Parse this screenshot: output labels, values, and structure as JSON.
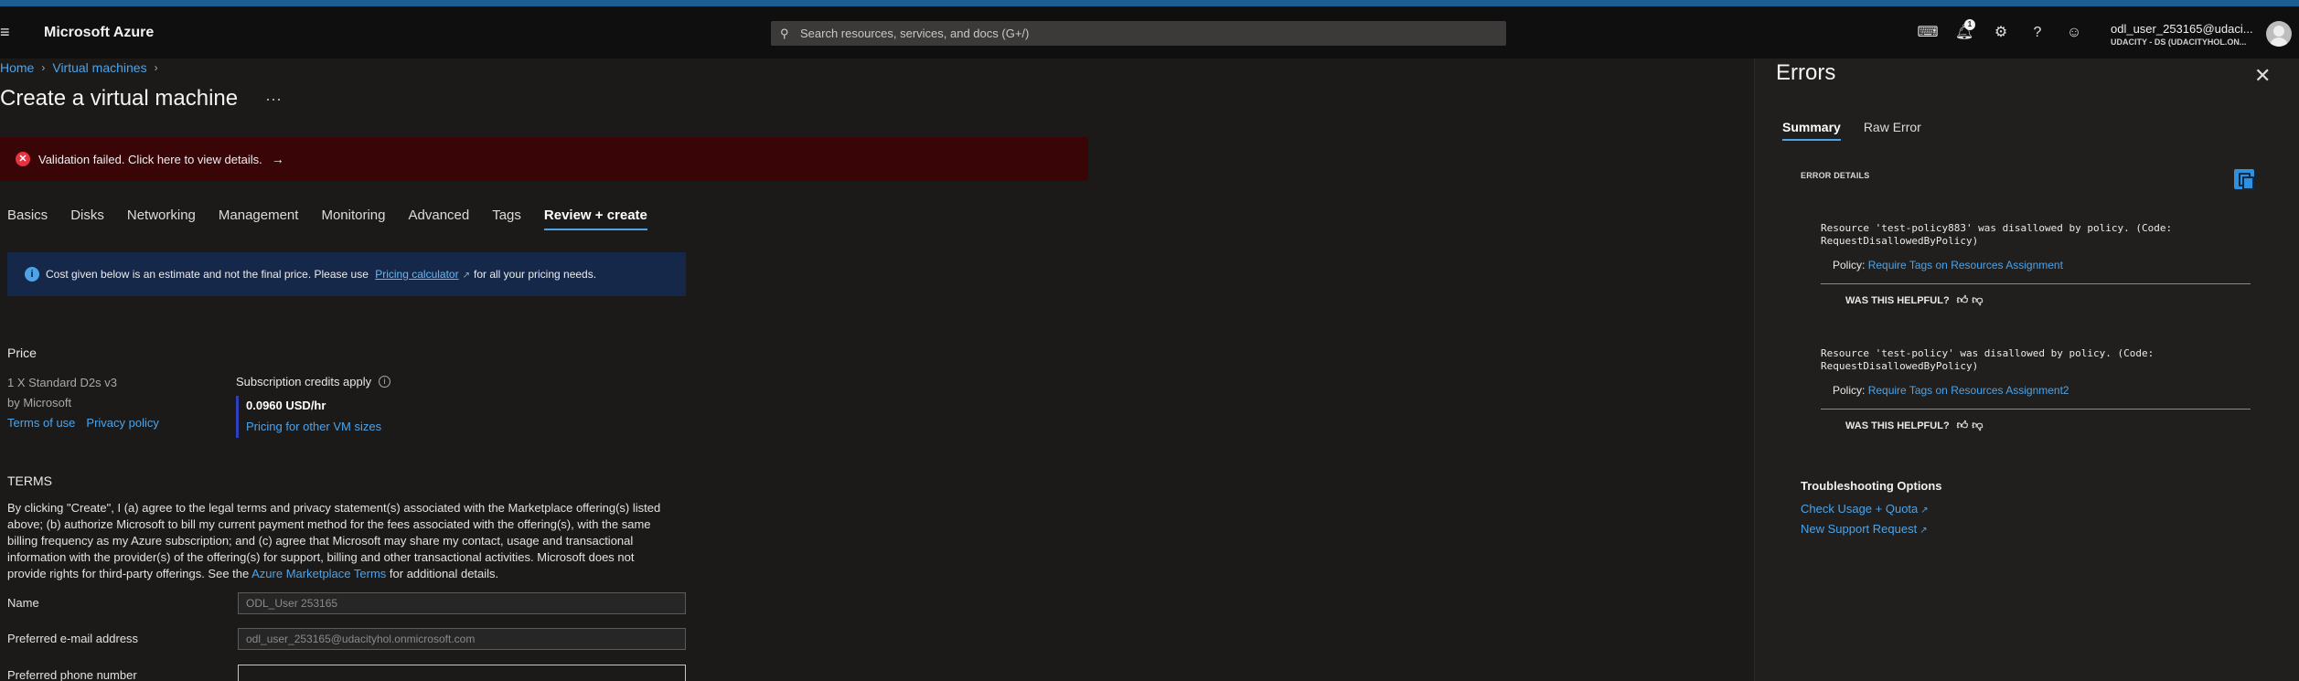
{
  "header": {
    "brand": "Microsoft Azure",
    "search_placeholder": "Search resources, services, and docs (G+/)",
    "notification_count": "1",
    "user_name": "odl_user_253165@udaci...",
    "user_tenant": "UDACITY - DS (UDACITYHOL.ON..."
  },
  "breadcrumb": {
    "home": "Home",
    "virtual_machines": "Virtual machines"
  },
  "page": {
    "title": "Create a virtual machine",
    "more": "···"
  },
  "validation": {
    "text": "Validation failed. Click here to view details.",
    "arrow": "→"
  },
  "tabs": [
    "Basics",
    "Disks",
    "Networking",
    "Management",
    "Monitoring",
    "Advanced",
    "Tags",
    "Review + create"
  ],
  "active_tab": "Review + create",
  "info": {
    "before": "Cost given below is an estimate and not the final price. Please use",
    "link": "Pricing calculator",
    "after": "for all your pricing needs."
  },
  "price": {
    "heading": "Price",
    "vm": "1 X Standard D2s v3",
    "by": "by Microsoft",
    "terms_link": "Terms of use",
    "privacy_link": "Privacy policy",
    "credits": "Subscription credits apply",
    "amount": "0.0960 USD/hr",
    "other_sizes": "Pricing for other VM sizes"
  },
  "terms": {
    "heading": "TERMS",
    "body": "By clicking \"Create\", I (a) agree to the legal terms and privacy statement(s) associated with the Marketplace offering(s) listed above; (b) authorize Microsoft to bill my current payment method for the fees associated with the offering(s), with the same billing frequency as my Azure subscription; and (c) agree that Microsoft may share my contact, usage and transactional information with the provider(s) of the offering(s) for support, billing and other transactional activities. Microsoft does not provide rights for third-party offerings. See the",
    "link": "Azure Marketplace Terms",
    "tail": "for additional details."
  },
  "form": {
    "name_label": "Name",
    "name_value": "ODL_User 253165",
    "email_label": "Preferred e-mail address",
    "email_value": "odl_user_253165@udacityhol.onmicrosoft.com",
    "phone_label": "Preferred phone number",
    "phone_value": ""
  },
  "errors_panel": {
    "title": "Errors",
    "tabs": [
      "Summary",
      "Raw Error"
    ],
    "details_heading": "ERROR DETAILS",
    "items": [
      {
        "message": "Resource 'test-policy883' was disallowed by policy. (Code: RequestDisallowedByPolicy)",
        "policy_label": "Policy:",
        "policy_link": "Require Tags on Resources Assignment",
        "helpful": "WAS THIS HELPFUL?"
      },
      {
        "message": "Resource 'test-policy' was disallowed by policy. (Code: RequestDisallowedByPolicy)",
        "policy_label": "Policy:",
        "policy_link": "Require Tags on Resources Assignment2",
        "helpful": "WAS THIS HELPFUL?"
      }
    ],
    "troubleshooting": {
      "heading": "Troubleshooting Options",
      "links": [
        "Check Usage + Quota",
        "New Support Request"
      ]
    }
  },
  "colors": {
    "accent": "#4da3e8",
    "error_banner": "#3a0507",
    "info_box": "#152849"
  }
}
